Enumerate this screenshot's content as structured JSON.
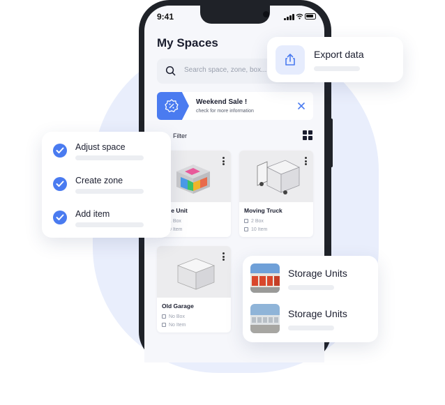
{
  "status_bar": {
    "time": "9:41"
  },
  "app": {
    "title": "My Spaces",
    "search_placeholder": "Search space, zone, box...",
    "promo": {
      "title": "Weekend Sale !",
      "subtitle": "check for more information"
    },
    "filter_label": "Filter",
    "spaces": [
      {
        "name": "rage Unit",
        "boxes": "1 Box",
        "items": "0 Item"
      },
      {
        "name": "Moving Truck",
        "boxes": "2 Box",
        "items": "10 Item"
      },
      {
        "name": "Old Garage",
        "boxes": "No Box",
        "items": "No Item"
      }
    ]
  },
  "export_card": {
    "title": "Export data",
    "icon": "upload-icon"
  },
  "task_card": {
    "items": [
      {
        "label": "Adjust space"
      },
      {
        "label": "Create zone"
      },
      {
        "label": "Add item"
      }
    ]
  },
  "units_card": {
    "items": [
      {
        "label": "Storage Units"
      },
      {
        "label": "Storage Units"
      }
    ]
  },
  "colors": {
    "accent": "#4a7bf0",
    "background_blob": "#e9eefc",
    "phone_frame": "#1f2228"
  }
}
